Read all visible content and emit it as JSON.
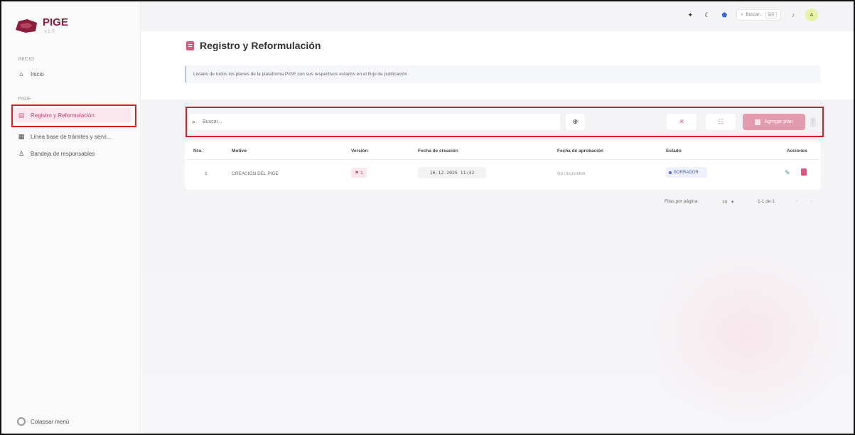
{
  "app": {
    "brand_name": "PIGE",
    "brand_sub": "v.1.0"
  },
  "sidebar": {
    "section_inicio": "INICIO",
    "section_pige": "PIGE",
    "items": [
      {
        "label": "Inicio",
        "icon": "home-icon"
      },
      {
        "label": "Registro y Reformulación",
        "icon": "document-icon",
        "active": true
      },
      {
        "label": "Línea base de trámites y servi...",
        "icon": "database-icon"
      },
      {
        "label": "Bandeja de responsables",
        "icon": "user-icon"
      }
    ],
    "collapse_label": "Colapsar menú"
  },
  "topbar": {
    "search_placeholder": "Buscar...",
    "search_shortcut": "⌘K",
    "avatar_initial": "A"
  },
  "page": {
    "title": "Registro y Reformulación",
    "info": "Listado de todos los planes de la plataforma PIGE con sus respectivos estados en el flujo de publicación"
  },
  "toolbar": {
    "search_placeholder": "Buscar...",
    "add_label": "Agregar plan"
  },
  "table": {
    "headers": [
      "Nro.",
      "Motivo",
      "Versión",
      "Fecha de creación",
      "Fecha de aprobación",
      "Estado",
      "Acciones"
    ],
    "rows": [
      {
        "nro": "1",
        "motivo": "CREACIÓN DEL PIGE",
        "version": "1",
        "fecha_creacion": "16-12-2025 11:32",
        "fecha_aprobacion": "No disponible",
        "estado": "BORRADOR"
      }
    ]
  },
  "pagination": {
    "rows_per_page_label": "Filas por página:",
    "rows_per_page": "10",
    "range": "1-1 de 1"
  },
  "colors": {
    "brand": "#8c1c3b",
    "accent": "#e0577f",
    "highlight": "#e01b24"
  }
}
